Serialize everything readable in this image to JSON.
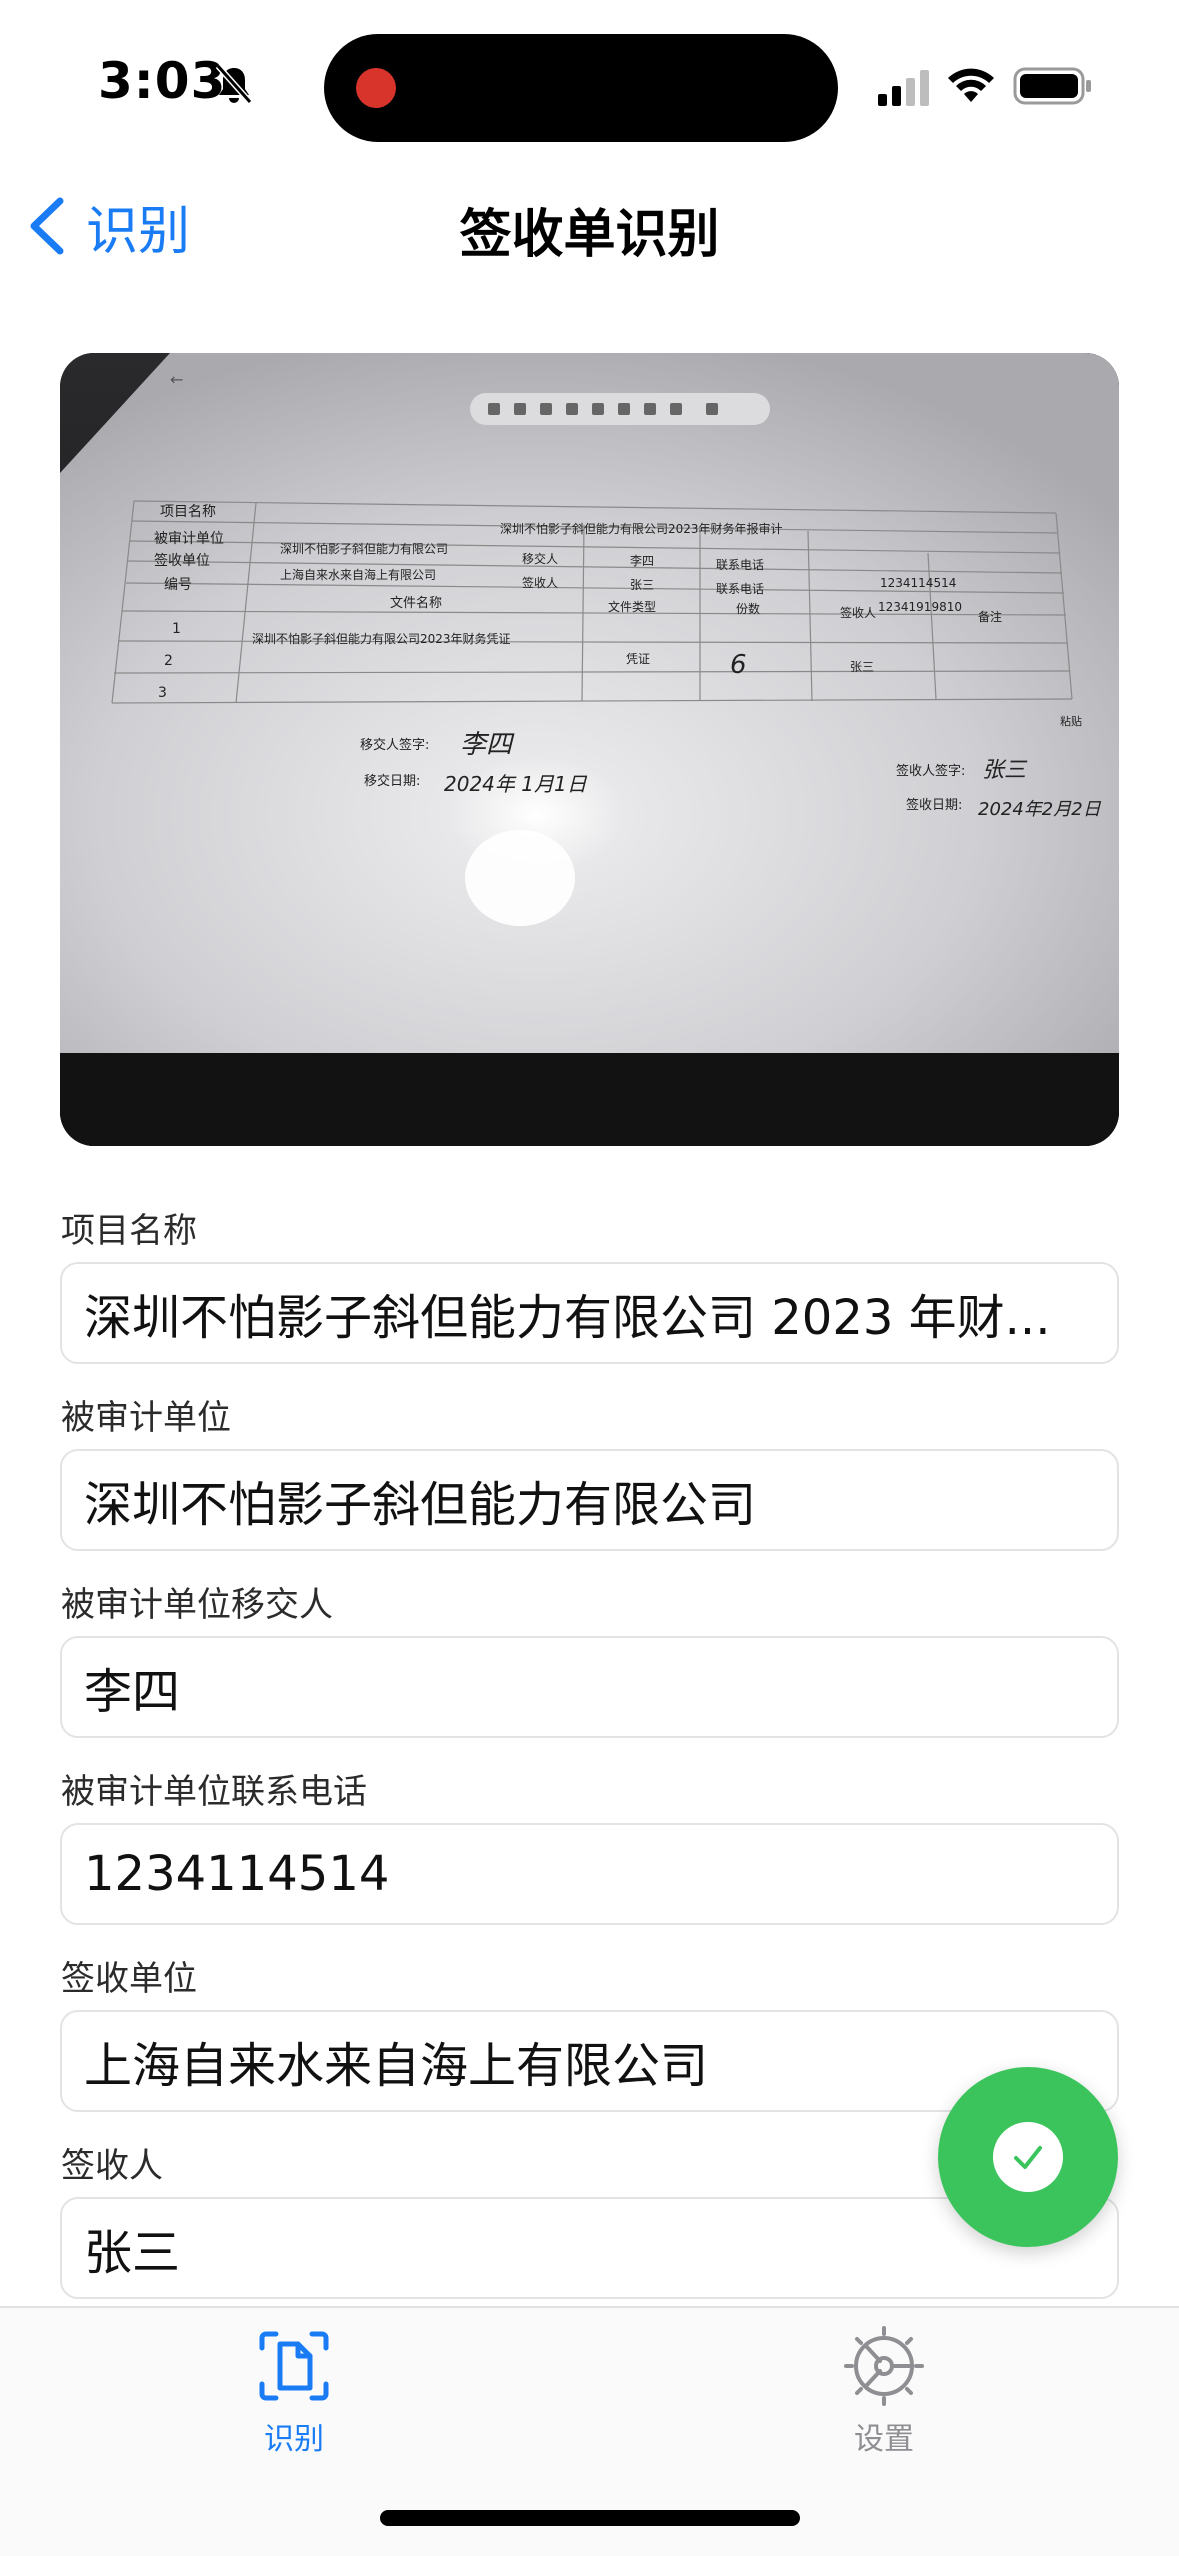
{
  "status_bar": {
    "time": "3:03",
    "icons": [
      "bell-slash-icon",
      "signal-icon",
      "wifi-icon",
      "battery-icon"
    ]
  },
  "nav": {
    "back_label": "识别",
    "title": "签收单识别"
  },
  "photo": {
    "toolbar_right": "粘贴",
    "table": {
      "row_project_label": "项目名称",
      "row_project_value": "深圳不怕影子斜但能力有限公司2023年财务年报审计",
      "row_audited_label": "被审计单位",
      "row_audited_value": "深圳不怕影子斜但能力有限公司",
      "transfer_person_label": "移交人",
      "transfer_person_value": "李四",
      "contact_label": "联系电话",
      "contact_value_1": "1234114514",
      "row_receiver_unit_label": "签收单位",
      "row_receiver_unit_value": "上海自来水来自海上有限公司",
      "receiver_label": "签收人",
      "receiver_value": "张三",
      "contact_value_2": "12341919810",
      "col_no": "编号",
      "col_file": "文件名称",
      "col_type": "文件类型",
      "col_count": "份数",
      "col_signer": "签收人",
      "col_note": "备注",
      "row1_no": "1",
      "row1_file": "深圳不怕影子斜但能力有限公司2023年财务凭证",
      "row1_type": "凭证",
      "row1_count": "6",
      "row1_signer": "张三",
      "row2_no": "2",
      "row3_no": "3",
      "sign_transfer_label": "移交人签字:",
      "sign_transfer_value": "李四",
      "date_transfer_label": "移交日期:",
      "date_transfer_value": "2024年 1月1日",
      "sign_receiver_label": "签收人签字:",
      "sign_receiver_value": "张三",
      "date_receiver_label": "签收日期:",
      "date_receiver_value": "2024年2月2日"
    }
  },
  "form": {
    "fields": [
      {
        "label": "项目名称",
        "value": "深圳不怕影子斜但能力有限公司 2023 年财..."
      },
      {
        "label": "被审计单位",
        "value": "深圳不怕影子斜但能力有限公司"
      },
      {
        "label": "被审计单位移交人",
        "value": "李四"
      },
      {
        "label": "被审计单位联系电话",
        "value": "1234114514"
      },
      {
        "label": "签收单位",
        "value": "上海自来水来自海上有限公司"
      },
      {
        "label": "签收人",
        "value": "张三"
      }
    ]
  },
  "fab": {
    "icon": "checkmark-icon"
  },
  "tabs": [
    {
      "label": "识别",
      "icon": "document-scan-icon",
      "active": true
    },
    {
      "label": "设置",
      "icon": "gear-icon",
      "active": false
    }
  ],
  "colors": {
    "accent": "#1a7cf5",
    "fab": "#3cc45c",
    "recording": "#d8342b"
  }
}
